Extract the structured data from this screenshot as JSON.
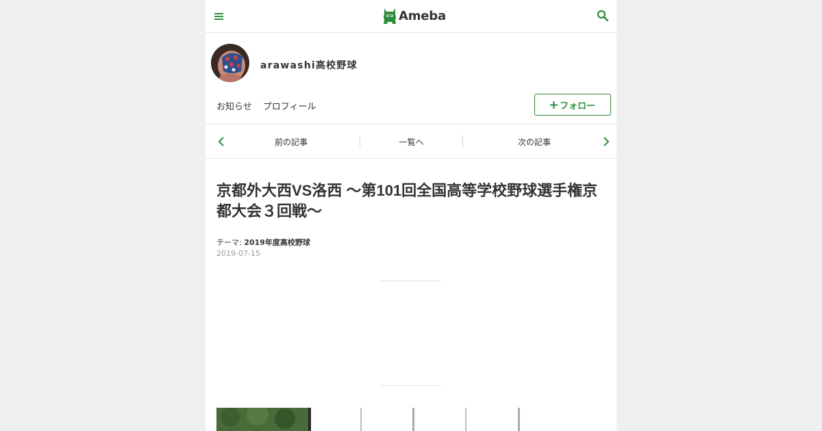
{
  "header": {
    "logo_text": "Ameba",
    "brand_color": "#2d8c3c"
  },
  "blog": {
    "title": "arawashi高校野球",
    "nav": [
      "お知らせ",
      "プロフィール"
    ],
    "follow_label": "フォロー"
  },
  "pager": {
    "prev": "前の記事",
    "list": "一覧へ",
    "next": "次の記事"
  },
  "article": {
    "title": "京都外大西VS洛西 ～第101回全国高等学校野球選手権京都大会３回戦～",
    "theme_label": "テーマ:",
    "theme_value": "2019年度高校野球",
    "date": "2019-07-15"
  }
}
